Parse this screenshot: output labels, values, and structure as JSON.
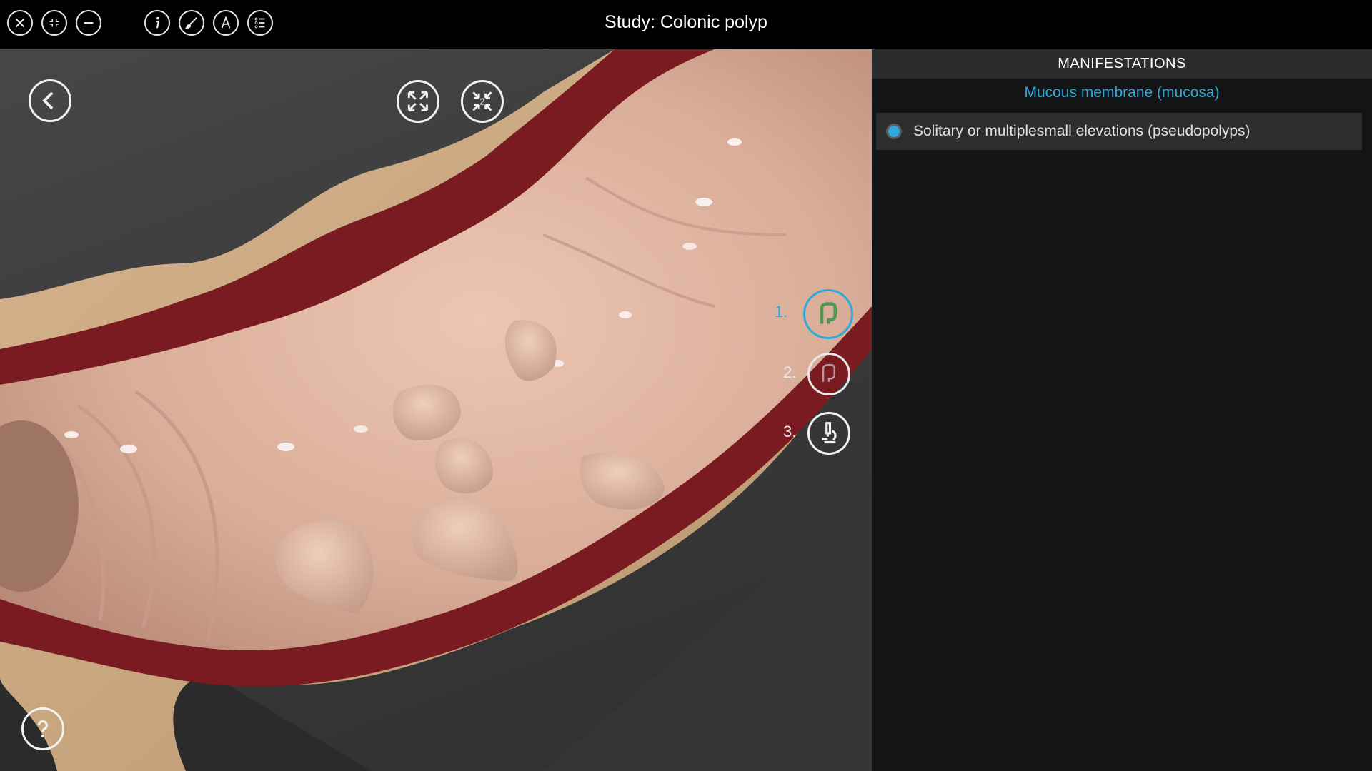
{
  "window": {
    "title": "Study: Colonic polyp"
  },
  "toolbar": {
    "left_icons": [
      "close-icon",
      "collapse-icon",
      "minimize-icon"
    ],
    "tool_icons": [
      "info-icon",
      "paint-brush-icon",
      "label-a-icon",
      "list-icon"
    ]
  },
  "viewport": {
    "nav": [
      "back-icon",
      "fullscreen-icon",
      "split-view-icon",
      "help-icon"
    ],
    "split_view_badge": "2",
    "steps": [
      {
        "label": "1.",
        "icon": "colon-icon",
        "active": true
      },
      {
        "label": "2.",
        "icon": "colon-outline-icon",
        "active": false
      },
      {
        "label": "3.",
        "icon": "microscope-icon",
        "active": false
      }
    ]
  },
  "panel": {
    "header": "MANIFESTATIONS",
    "subtitle": "Mucous membrane (mucosa)",
    "items": [
      {
        "label": "Solitary or multiplesmall elevations (pseudopolyps)",
        "selected": true
      }
    ]
  },
  "colors": {
    "accent": "#2fa9d9",
    "tissue": "#e2b9a6",
    "tissue_wall": "#7a1b22",
    "panel_bg": "#121416"
  }
}
